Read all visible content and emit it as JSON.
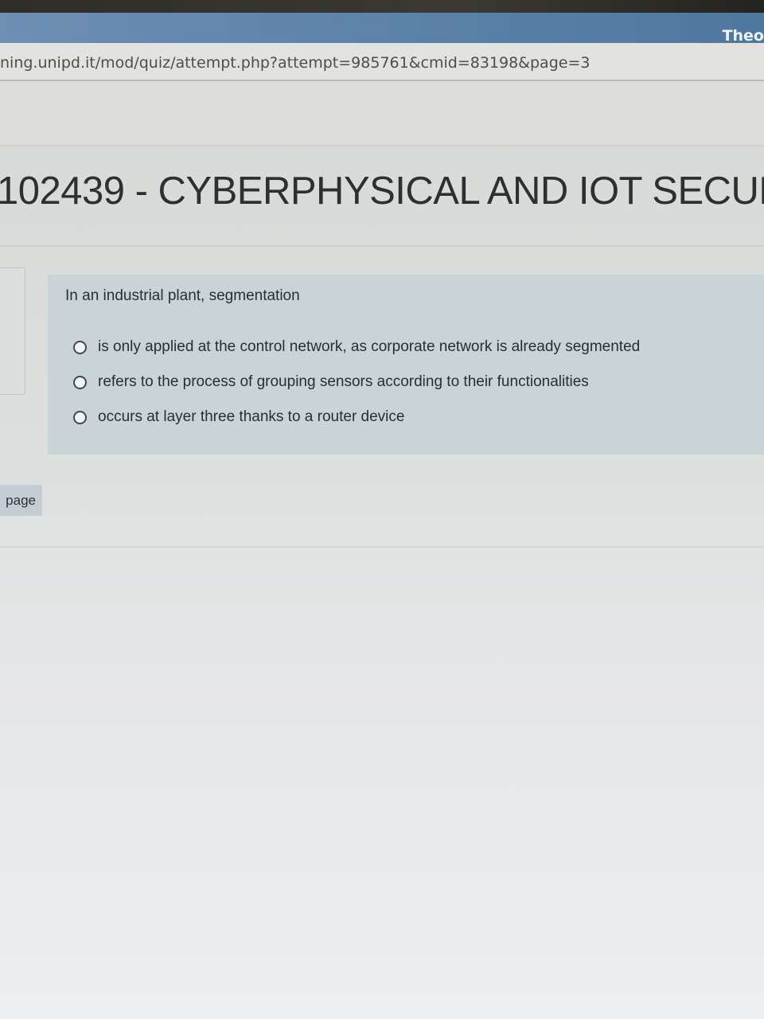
{
  "window": {
    "user_name": "Theo"
  },
  "address_bar": {
    "url": "ning.unipd.it/mod/quiz/attempt.php?attempt=985761&cmid=83198&page=3"
  },
  "course": {
    "title": "102439 - CYBERPHYSICAL AND IOT SECUR"
  },
  "question": {
    "text": "In an industrial plant, segmentation",
    "answers": [
      {
        "label": "is only applied at the control network, as corporate network is already segmented",
        "selected": false
      },
      {
        "label": "refers to the process of grouping sensors according to their functionalities",
        "selected": false
      },
      {
        "label": "occurs at layer three thanks to a router device",
        "selected": false
      }
    ]
  },
  "navigation": {
    "page_button_label": "page"
  }
}
